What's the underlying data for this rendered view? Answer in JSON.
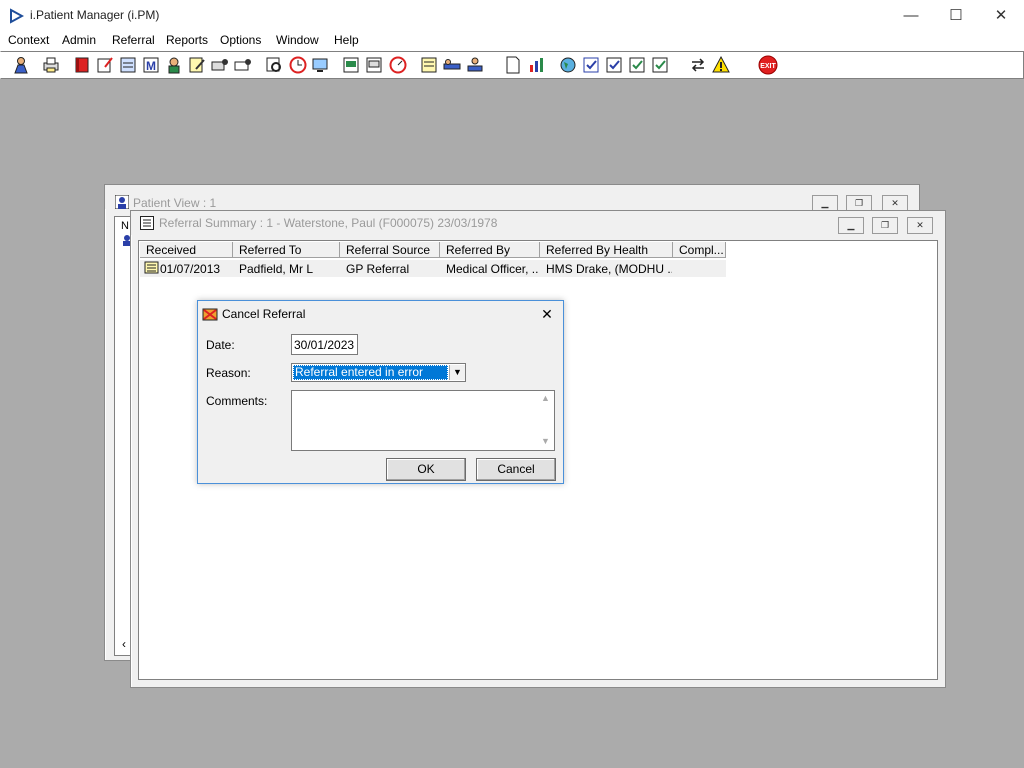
{
  "app": {
    "title": "i.Patient Manager (i.PM)"
  },
  "window_controls": {
    "minimize": "—",
    "maximize": "☐",
    "close": "✕"
  },
  "menu": [
    "Context",
    "Admin",
    "Referral",
    "Reports",
    "Options",
    "Window",
    "Help"
  ],
  "toolbar": {
    "exit_label": "EXIT"
  },
  "patient_view": {
    "title": "Patient View : 1",
    "col_fragment": "N"
  },
  "referral_summary": {
    "title": "Referral Summary : 1 - Waterstone, Paul (F000075) 23/03/1978",
    "columns": [
      "Received",
      "Referred To",
      "Referral Source",
      "Referred By",
      "Referred By Health Org.",
      "Compl..."
    ],
    "rows": [
      {
        "received": "01/07/2013",
        "referred_to": "Padfield, Mr L",
        "source": "GP Referral",
        "referred_by": "Medical Officer, ...",
        "health_org": "HMS Drake, (MODHU ...",
        "compl": ""
      }
    ]
  },
  "dialog": {
    "title": "Cancel Referral",
    "date_label": "Date:",
    "date_value": "30/01/2023",
    "reason_label": "Reason:",
    "reason_value": "Referral entered in error",
    "comments_label": "Comments:",
    "comments_value": "",
    "ok_label": "OK",
    "cancel_label": "Cancel"
  },
  "colors": {
    "selection": "#0078d7",
    "exit": "#e02020",
    "desktop": "#ababab"
  }
}
